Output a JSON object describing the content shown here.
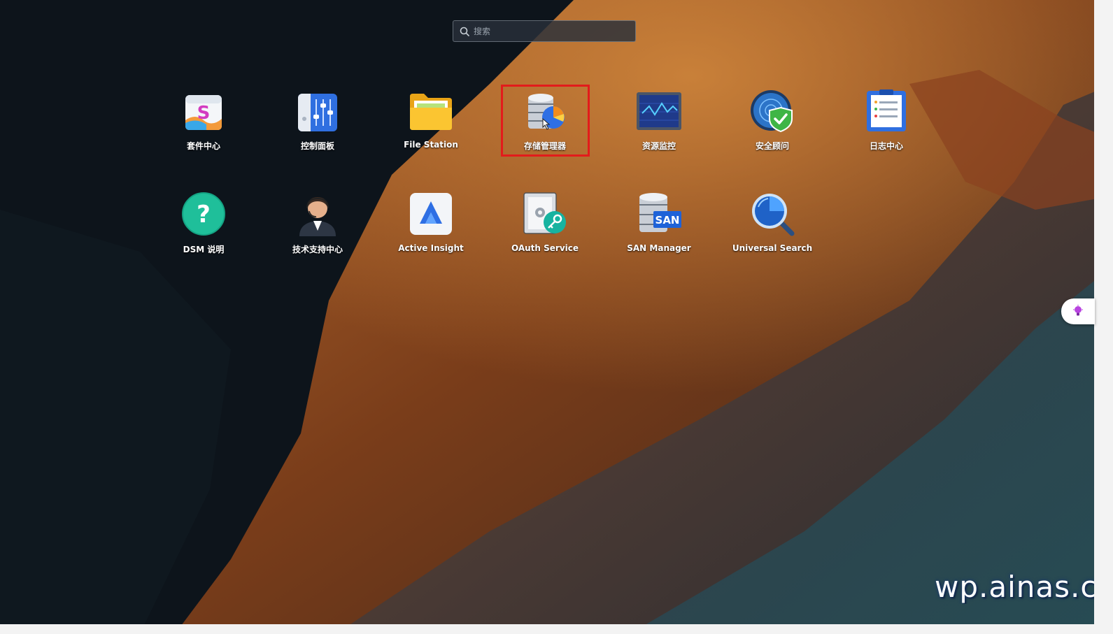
{
  "search": {
    "placeholder": "搜索"
  },
  "apps": {
    "package_center": {
      "label": "套件中心",
      "icon": "package-center-icon"
    },
    "control_panel": {
      "label": "控制面板",
      "icon": "control-panel-icon"
    },
    "file_station": {
      "label": "File Station",
      "icon": "folder-icon"
    },
    "storage_manager": {
      "label": "存储管理器",
      "icon": "storage-manager-icon"
    },
    "resource_monitor": {
      "label": "资源监控",
      "icon": "resource-monitor-icon"
    },
    "security_advisor": {
      "label": "安全顾问",
      "icon": "security-shield-icon"
    },
    "log_center": {
      "label": "日志中心",
      "icon": "log-center-icon"
    },
    "dsm_help": {
      "label": "DSM 说明",
      "icon": "help-question-icon"
    },
    "support_center": {
      "label": "技术支持中心",
      "icon": "support-agent-icon"
    },
    "active_insight": {
      "label": "Active Insight",
      "icon": "active-insight-icon"
    },
    "oauth_service": {
      "label": "OAuth Service",
      "icon": "oauth-key-icon"
    },
    "san_manager": {
      "label": "SAN Manager",
      "icon": "san-manager-icon",
      "badge": "SAN"
    },
    "universal_search": {
      "label": "Universal Search",
      "icon": "magnifier-search-icon"
    }
  },
  "highlight": {
    "target": "storage_manager",
    "color": "#e31b1b"
  },
  "watermark": {
    "text": "wp.ainas.cc"
  },
  "colors": {
    "label_text": "#ffffff",
    "highlight": "#e31b1b"
  }
}
